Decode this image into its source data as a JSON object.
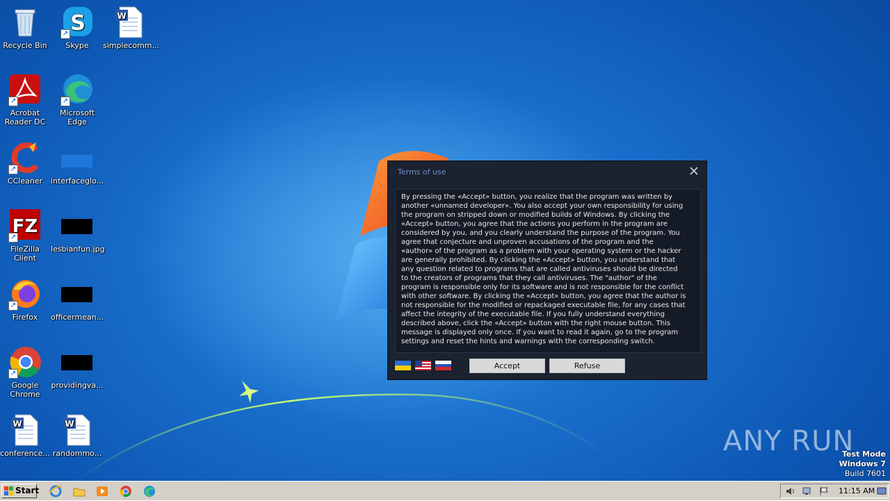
{
  "desktop_icons": [
    {
      "label": "Recycle Bin",
      "icon": "recycle-bin-icon"
    },
    {
      "label": "Skype",
      "icon": "skype-icon"
    },
    {
      "label": "simplecomm...",
      "icon": "word-document-icon"
    },
    {
      "label": "Acrobat Reader DC",
      "icon": "acrobat-icon"
    },
    {
      "label": "Microsoft Edge",
      "icon": "edge-icon"
    },
    {
      "label": "CCleaner",
      "icon": "ccleaner-icon"
    },
    {
      "label": "interfaceglo...",
      "icon": "image-file-icon"
    },
    {
      "label": "FileZilla Client",
      "icon": "filezilla-icon"
    },
    {
      "label": "lesbianfun.jpg",
      "icon": "image-file-icon"
    },
    {
      "label": "Firefox",
      "icon": "firefox-icon"
    },
    {
      "label": "officermean...",
      "icon": "image-file-icon"
    },
    {
      "label": "Google Chrome",
      "icon": "chrome-icon"
    },
    {
      "label": "providingva...",
      "icon": "image-file-icon"
    },
    {
      "label": "conference...",
      "icon": "word-document-icon"
    },
    {
      "label": "randommo...",
      "icon": "word-document-icon"
    }
  ],
  "dialog": {
    "title": "Terms of use",
    "body": "By pressing the «Accept» button, you realize that the program was written by another «unnamed developer». You also accept your own responsibility for using the program on stripped down or modified builds of Windows. By clicking the «Accept» button, you agree that the actions you perform in the program are considered by you, and you clearly understand the purpose of the program. You agree that conjecture and unproven accusations of the program and the «author» of the program as a problem with your operating system or the hacker are generally prohibited. By clicking the «Accept» button, you understand that any question related to programs that are called antiviruses should be directed to the creators of programs that they call antiviruses. The \"author\" of the program is responsible only for its software and is not responsible for the conflict with other software. By clicking the «Accept» button, you agree that the author is not responsible for the modified or repackaged executable file, for any cases that affect the integrity of the executable file. If you fully understand everything described above, click the «Accept» button with the right mouse button. This message is displayed only once. If you want to read it again, go to the program settings and reset the hints and warnings with the corresponding switch.",
    "accept_label": "Accept",
    "refuse_label": "Refuse",
    "language_flags": [
      "ukraine-flag-icon",
      "usa-flag-icon",
      "russia-flag-icon"
    ]
  },
  "watermark": "ANY RUN",
  "os_info": {
    "line1": "Test Mode",
    "line2": "Windows 7",
    "line3": "Build 7601"
  },
  "taskbar": {
    "start_label": "Start",
    "pinned": [
      "internet-explorer-icon",
      "file-explorer-icon",
      "media-player-icon",
      "chrome-icon",
      "edge-icon"
    ],
    "clock": "11:15 AM"
  },
  "colors": {
    "dialog_bg": "#1b2230",
    "dialog_title": "#6f8fc6",
    "desktop_blue": "#1a6fcc",
    "taskbar": "#d4d0c8"
  }
}
